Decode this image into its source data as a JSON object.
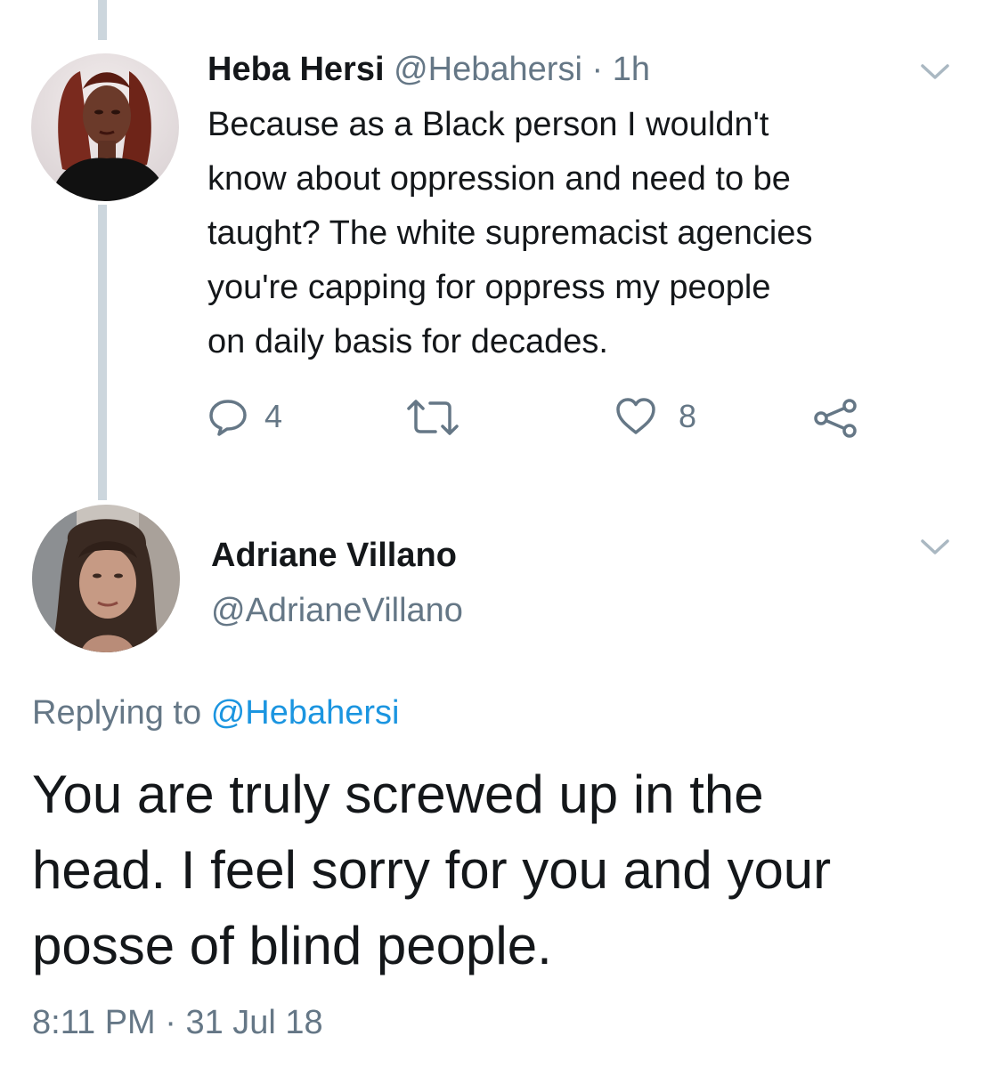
{
  "tweet1": {
    "name": "Heba Hersi",
    "handle": "@Hebahersi",
    "separator": "·",
    "time": "1h",
    "lines": [
      "Because as a Black person I wouldn't",
      "know about oppression and need to be",
      "taught? The white supremacist agencies",
      "you're capping for oppress my people",
      "on daily basis for decades."
    ],
    "actions": {
      "reply_count": "4",
      "retweet_count": "",
      "like_count": "8"
    },
    "icons": [
      "reply-icon",
      "retweet-icon",
      "like-icon",
      "share-icon",
      "chevron-down-icon"
    ]
  },
  "tweet2": {
    "name": "Adriane Villano",
    "handle": "@AdrianeVillano",
    "replying_prefix": "Replying to",
    "replying_to": "@Hebahersi",
    "lines": [
      "You are truly screwed up in the",
      "head. I feel sorry for you and your",
      "posse of blind people."
    ],
    "timestamp": "8:11 PM · 31 Jul 18"
  },
  "colors": {
    "text": "#14171a",
    "secondary": "#657786",
    "link": "#1b95e0",
    "thread_line": "#ccd6dd"
  }
}
